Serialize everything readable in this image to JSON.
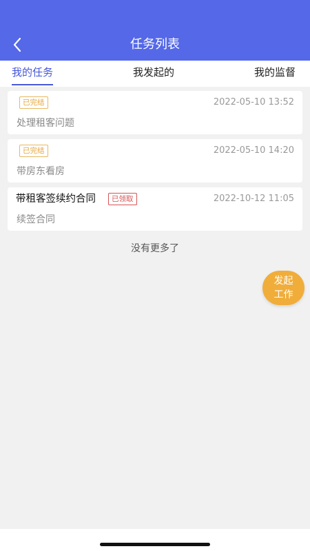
{
  "header": {
    "title": "任务列表",
    "back_icon": "chevron-left-icon"
  },
  "tabs": [
    {
      "label": "我的任务",
      "active": true
    },
    {
      "label": "我发起的",
      "active": false
    },
    {
      "label": "我的监督",
      "active": false
    }
  ],
  "tasks": [
    {
      "title": "",
      "status": "已完结",
      "time": "2022-05-10 13:52",
      "desc": "处理租客问题"
    },
    {
      "title": "",
      "status": "已完结",
      "time": "2022-05-10 14:20",
      "desc": "带房东看房"
    },
    {
      "title": "带租客签续约合同",
      "status": "已领取",
      "time": "2022-10-12 11:05",
      "desc": "续签合同"
    }
  ],
  "list_end_text": "没有更多了",
  "fab": {
    "line1": "发起",
    "line2": "工作"
  },
  "colors": {
    "header_bg": "#5468e8",
    "active_tab": "#4758d8",
    "status_done": "#e6a53a",
    "status_claimed": "#d75252",
    "fab_bg": "#f0ad3a",
    "page_bg": "#f1f1f1"
  }
}
